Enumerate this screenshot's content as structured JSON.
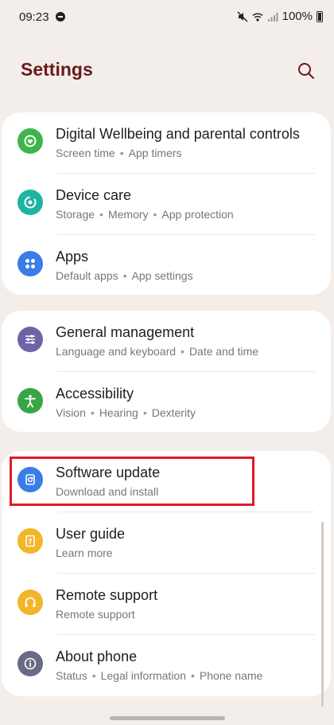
{
  "status_bar": {
    "time": "09:23",
    "battery": "100%"
  },
  "header": {
    "title": "Settings"
  },
  "groups": [
    {
      "items": [
        {
          "title": "Digital Wellbeing and parental controls",
          "subtitle": [
            "Screen time",
            "App timers"
          ],
          "icon": "digital-wellbeing-icon",
          "icon_color": "#3db54a"
        },
        {
          "title": "Device care",
          "subtitle": [
            "Storage",
            "Memory",
            "App protection"
          ],
          "icon": "device-care-icon",
          "icon_color": "#1fb3a3"
        },
        {
          "title": "Apps",
          "subtitle": [
            "Default apps",
            "App settings"
          ],
          "icon": "apps-icon",
          "icon_color": "#3a7de6"
        }
      ]
    },
    {
      "items": [
        {
          "title": "General management",
          "subtitle": [
            "Language and keyboard",
            "Date and time"
          ],
          "icon": "general-management-icon",
          "icon_color": "#6d64a8"
        },
        {
          "title": "Accessibility",
          "subtitle": [
            "Vision",
            "Hearing",
            "Dexterity"
          ],
          "icon": "accessibility-icon",
          "icon_color": "#3aa547"
        }
      ]
    },
    {
      "items": [
        {
          "title": "Software update",
          "subtitle": [
            "Download and install"
          ],
          "icon": "software-update-icon",
          "icon_color": "#3a7de6"
        },
        {
          "title": "User guide",
          "subtitle": [
            "Learn more"
          ],
          "icon": "user-guide-icon",
          "icon_color": "#f3b52a"
        },
        {
          "title": "Remote support",
          "subtitle": [
            "Remote support"
          ],
          "icon": "remote-support-icon",
          "icon_color": "#f3b52a"
        },
        {
          "title": "About phone",
          "subtitle": [
            "Status",
            "Legal information",
            "Phone name"
          ],
          "icon": "about-phone-icon",
          "icon_color": "#6a6a86"
        }
      ]
    }
  ],
  "highlight_color": "#e0192a"
}
